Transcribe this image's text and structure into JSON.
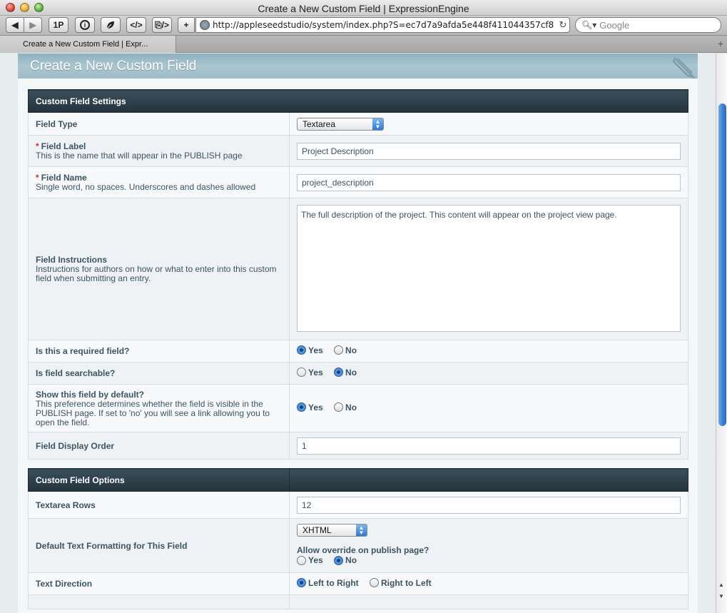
{
  "window": {
    "title": "Create a New Custom Field | ExpressionEngine"
  },
  "toolbar": {
    "onepass_label": "1P",
    "info_label": "i",
    "code_label": "</>",
    "validate_label": "⎘/>",
    "add_label": "+",
    "address": "http://appleseedstudio/system/index.php?S=ec7d7a9afda5e448f411044357cf8",
    "search_placeholder": "Google"
  },
  "tab": {
    "label": "Create a New Custom Field | Expr..."
  },
  "page": {
    "title": "Create a New Custom Field"
  },
  "settings": {
    "header": "Custom Field Settings",
    "field_type": {
      "label": "Field Type",
      "value": "Textarea"
    },
    "field_label": {
      "label": "Field Label",
      "sub": "This is the name that will appear in the PUBLISH page",
      "value": "Project Description"
    },
    "field_name": {
      "label": "Field Name",
      "sub": "Single word, no spaces. Underscores and dashes allowed",
      "value": "project_description"
    },
    "instructions": {
      "label": "Field Instructions",
      "sub": "Instructions for authors on how or what to enter into this custom field when submitting an entry.",
      "value": "The full description of the project. This content will appear on the project view page."
    },
    "required": {
      "label": "Is this a required field?",
      "yes": "Yes",
      "no": "No",
      "selected": "yes"
    },
    "searchable": {
      "label": "Is field searchable?",
      "yes": "Yes",
      "no": "No",
      "selected": "no"
    },
    "show_default": {
      "label": "Show this field by default?",
      "sub": "This preference determines whether the field is visible in the PUBLISH page. If set to 'no' you will see a link allowing you to open the field.",
      "yes": "Yes",
      "no": "No",
      "selected": "yes"
    },
    "display_order": {
      "label": "Field Display Order",
      "value": "1"
    }
  },
  "options": {
    "header": "Custom Field Options",
    "textarea_rows": {
      "label": "Textarea Rows",
      "value": "12"
    },
    "formatting": {
      "label": "Default Text Formatting for This Field",
      "value": "XHTML",
      "override_label": "Allow override on publish page?",
      "yes": "Yes",
      "no": "No",
      "selected": "no"
    },
    "direction": {
      "label": "Text Direction",
      "ltr": "Left to Right",
      "rtl": "Right to Left",
      "selected": "ltr"
    }
  }
}
